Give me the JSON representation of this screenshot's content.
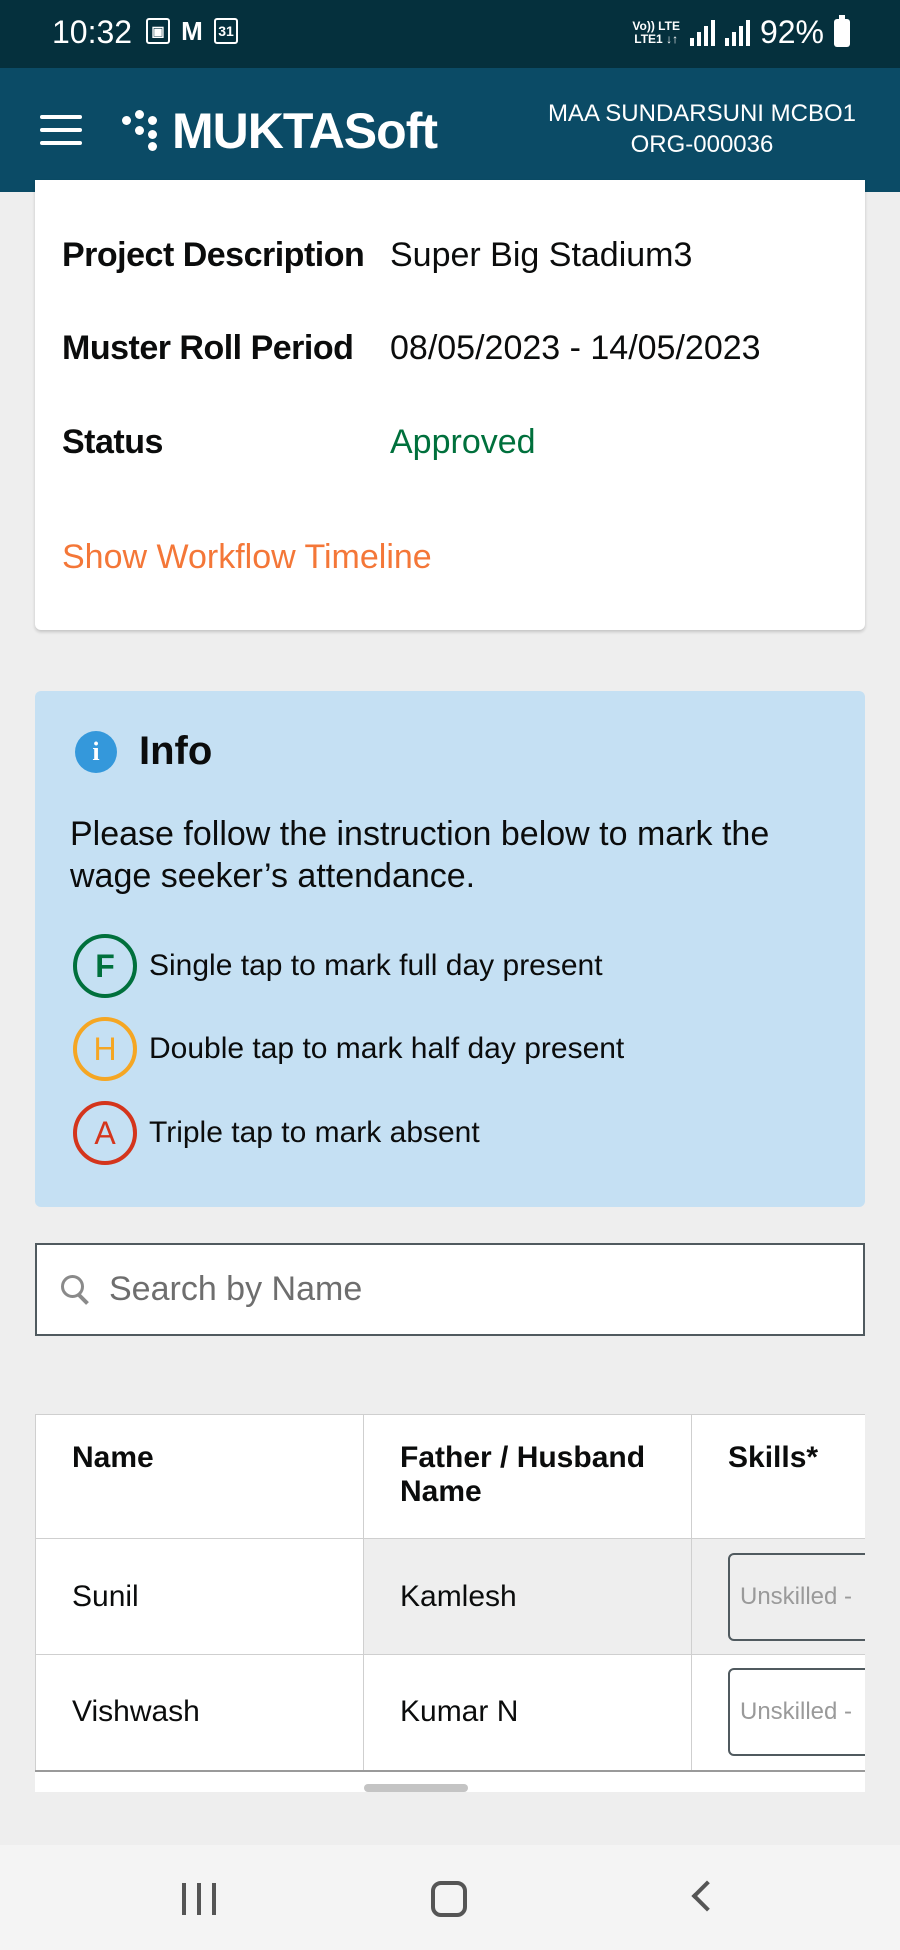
{
  "status_bar": {
    "time": "10:32",
    "left_icons": [
      "gallery-icon",
      "gmail-icon",
      "calendar-icon"
    ],
    "calendar_day": "31",
    "network_label_top": "Vo)) LTE",
    "network_label_bottom": "LTE1 ↓↑",
    "battery": "92%"
  },
  "header": {
    "app_name": "MUKTASoft",
    "org_name": "MAA SUNDARSUNI MCBO1",
    "org_id": "ORG-000036"
  },
  "details": {
    "rows": [
      {
        "label": "Project Description",
        "value": "Super Big Stadium3"
      },
      {
        "label": "Muster Roll Period",
        "value": "08/05/2023 - 14/05/2023"
      },
      {
        "label": "Status",
        "value": "Approved"
      }
    ],
    "status_color": "#00703c",
    "workflow_link": "Show Workflow Timeline",
    "link_color": "#f47738"
  },
  "info": {
    "title": "Info",
    "text": "Please follow the instruction below to mark the wage seeker’s attendance.",
    "legend": [
      {
        "symbol": "F",
        "text": "Single tap to mark full day present",
        "color": "#00703c"
      },
      {
        "symbol": "H",
        "text": "Double tap to mark half day present",
        "color": "#f5a623"
      },
      {
        "symbol": "A",
        "text": "Triple tap to mark  absent",
        "color": "#d4351c"
      }
    ]
  },
  "search": {
    "placeholder": "Search by Name"
  },
  "table": {
    "headers": [
      "Name",
      "Father / Husband Name",
      "Skills*"
    ],
    "rows": [
      {
        "name": "Sunil",
        "guardian": "Kamlesh",
        "skill": "Unskilled -"
      },
      {
        "name": "Vishwash",
        "guardian": "Kumar N",
        "skill": "Unskilled -"
      }
    ]
  },
  "nav": {
    "icons": [
      "recent-apps-icon",
      "home-icon",
      "back-icon"
    ]
  }
}
